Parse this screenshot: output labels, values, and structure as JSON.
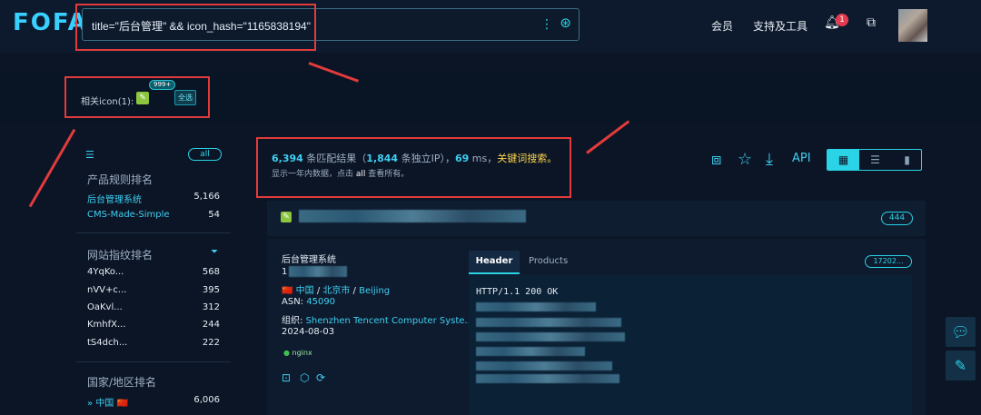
{
  "brand": {
    "logo_text": "FOFA"
  },
  "search": {
    "query": "title=\"后台管理\" && icon_hash=\"1165838194\""
  },
  "nav": {
    "member": "会员",
    "support": "支持及工具",
    "notifications_count": "1"
  },
  "related_icons": {
    "label": "相关icon(1):",
    "count_badge": "999+",
    "select_all": "全选"
  },
  "sidebar": {
    "all_label": "all",
    "product_rank_title": "产品规则排名",
    "product_rank": [
      {
        "name": "后台管理系统",
        "count": "5,166"
      },
      {
        "name": "CMS-Made-Simple",
        "count": "54"
      }
    ],
    "fingerprint_rank_title": "网站指纹排名",
    "fingerprint_rank": [
      {
        "name": "4YqKo...",
        "count": "568"
      },
      {
        "name": "nVV+c...",
        "count": "395"
      },
      {
        "name": "OaKvl...",
        "count": "312"
      },
      {
        "name": "KmhfX...",
        "count": "244"
      },
      {
        "name": "tS4dch...",
        "count": "222"
      }
    ],
    "country_rank_title": "国家/地区排名",
    "country_rank": [
      {
        "name": "中国",
        "flag": "🇨🇳",
        "count": "6,006"
      }
    ]
  },
  "results": {
    "total": "6,394",
    "total_suffix": " 条匹配结果（",
    "ips": "1,844",
    "ips_suffix": " 条独立IP），",
    "ms": "69",
    "ms_suffix": " ms，",
    "keyword_search": "关键词搜索。",
    "note_prefix": "显示一年内数据，点击 ",
    "note_all": "all",
    "note_suffix": " 查看所有。",
    "api_label": "API"
  },
  "card": {
    "count_pill": "444",
    "title": "后台管理系统",
    "ip_prefix": "1",
    "country": "中国",
    "city": "北京市",
    "city_en": "Beijing",
    "asn_label": "ASN:",
    "asn": "45090",
    "org_label": "组织:",
    "org": "Shenzhen Tencent Computer Syste...",
    "date": "2024-08-03",
    "server_tag": "nginx",
    "tabs": {
      "header": "Header",
      "products": "Products"
    },
    "ip_pill": "17202...",
    "http_status": "HTTP/1.1 200 OK"
  },
  "colors": {
    "accent": "#2ad3e6",
    "keyword": "#ffd54a",
    "background": "#0b1526",
    "annotation": "#e23b3b"
  }
}
